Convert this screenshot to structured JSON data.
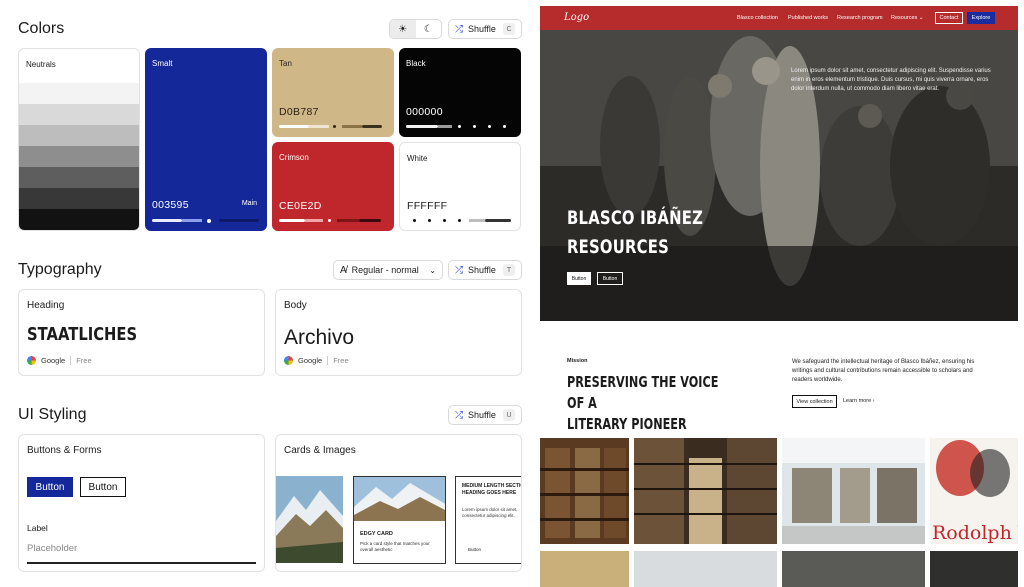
{
  "colors": {
    "title": "Colors",
    "shuffle_label": "Shuffle",
    "shuffle_key": "C",
    "neutrals_label": "Neutrals",
    "swatches": [
      {
        "name": "Smalt",
        "hex": "003595",
        "tag": "Main",
        "color": "#14289a",
        "text": "#ffffff"
      },
      {
        "name": "Tan",
        "hex": "D0B787",
        "color": "#d0b787",
        "text": "#2a2317"
      },
      {
        "name": "Black",
        "hex": "000000",
        "color": "#050505",
        "text": "#ffffff"
      },
      {
        "name": "Crimson",
        "hex": "CE0E2D",
        "color": "#c0272c",
        "text": "#ffffff"
      },
      {
        "name": "White",
        "hex": "FFFFFF",
        "color": "#ffffff",
        "text": "#1b1b1b"
      }
    ]
  },
  "typography": {
    "title": "Typography",
    "style_select": "Regular - normal",
    "shuffle_label": "Shuffle",
    "shuffle_key": "T",
    "heading": {
      "label": "Heading",
      "font": "STAATLICHES",
      "source": "Google",
      "license": "Free"
    },
    "body": {
      "label": "Body",
      "font": "Archivo",
      "source": "Google",
      "license": "Free"
    }
  },
  "ui_styling": {
    "title": "UI Styling",
    "shuffle_label": "Shuffle",
    "shuffle_key": "U",
    "buttons_forms": {
      "label": "Buttons & Forms",
      "primary_button": "Button",
      "secondary_button": "Button",
      "field_label": "Label",
      "placeholder": "Placeholder"
    },
    "cards_images": {
      "label": "Cards & Images",
      "edgy_card_title": "EDGY CARD",
      "edgy_card_text": "Pick a card style that matches your overall aesthetic",
      "medium_title": "MEDIUM LENGTH SECTION HEADING GOES HERE",
      "medium_text": "Lorem ipsum dolor sit amet, consectetur adipiscing elit.",
      "medium_button": "Button"
    }
  },
  "preview": {
    "logo": "Logo",
    "nav": [
      "Blasco collection",
      "Published works",
      "Research program",
      "Resources"
    ],
    "contact": "Contact",
    "explore": "Explore",
    "hero_text": "Lorem ipsum dolor sit amet, consectetur adipiscing elit. Suspendisse varius enim in eros elementum tristique. Duis cursus, mi quis viverra ornare, eros dolor interdum nulla, ut commodo diam libero vitae erat.",
    "hero_title_1": "BLASCO IBÁÑEZ",
    "hero_title_2": "RESOURCES",
    "hero_button_1": "Button",
    "hero_button_2": "Button",
    "mission_label": "Mission",
    "mission_title_1": "PRESERVING THE VOICE OF A",
    "mission_title_2": "LITERARY PIONEER",
    "mission_body": "We safeguard the intellectual heritage of Blasco Ibáñez, ensuring his writings and cultural contributions remain accessible to scholars and readers worldwide.",
    "view_collection": "View collection",
    "learn_more": "Learn more",
    "poster_text": "Rodolph Va"
  }
}
